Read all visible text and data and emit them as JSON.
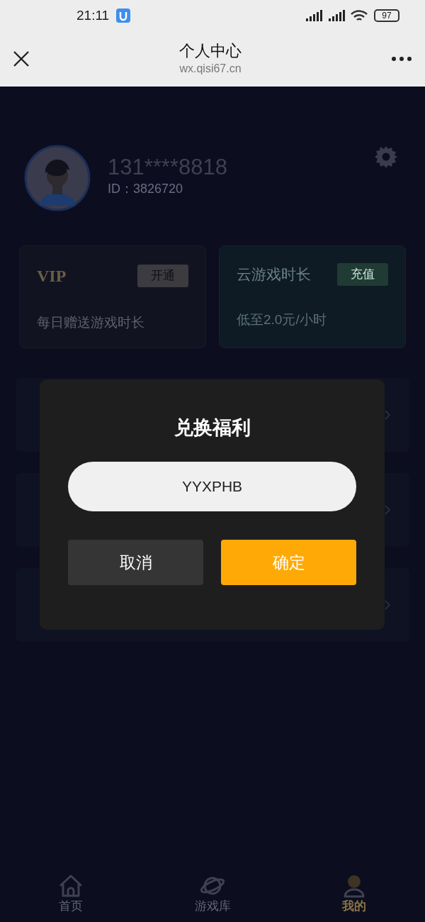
{
  "status_bar": {
    "time": "21:11",
    "battery": "97"
  },
  "browser_header": {
    "title": "个人中心",
    "url": "wx.qisi67.cn"
  },
  "profile": {
    "phone": "131****8818",
    "id": "ID：3826720"
  },
  "cards": [
    {
      "kind": "vip",
      "title": "VIP",
      "action": "开通",
      "subtitle": "每日赠送游戏时长"
    },
    {
      "kind": "cloud",
      "title": "云游戏时长",
      "action": "充值",
      "subtitle": "低至2.0元/小时"
    }
  ],
  "menu_rows": [
    {
      "kind": "link"
    },
    {
      "kind": "link"
    },
    {
      "kind": "link"
    }
  ],
  "dialog": {
    "title": "兑换福利",
    "code_value": "YYXPHB",
    "cancel": "取消",
    "confirm": "确定"
  },
  "tab_bar": [
    {
      "kind": "home",
      "label": "首页",
      "selected": false
    },
    {
      "kind": "planet",
      "label": "游戏库",
      "selected": false
    },
    {
      "kind": "user",
      "label": "我的",
      "selected": true
    }
  ]
}
